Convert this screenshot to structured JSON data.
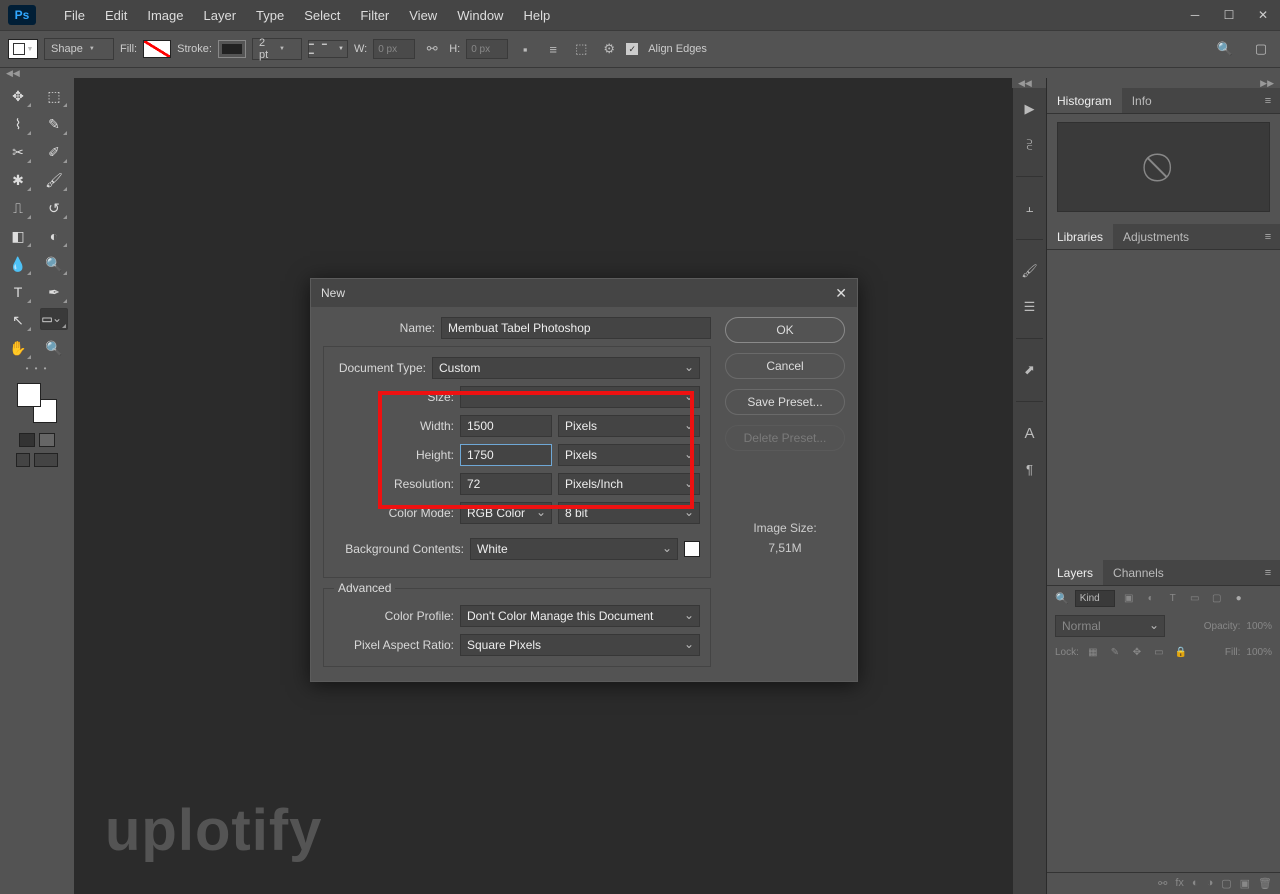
{
  "app": {
    "logo": "Ps"
  },
  "menu": [
    "File",
    "Edit",
    "Image",
    "Layer",
    "Type",
    "Select",
    "Filter",
    "View",
    "Window",
    "Help"
  ],
  "options": {
    "shape": "Shape",
    "fill_label": "Fill:",
    "stroke_label": "Stroke:",
    "stroke_w": "2 pt",
    "w_label": "W:",
    "w_val": "0 px",
    "h_label": "H:",
    "h_val": "0 px",
    "align_edges": "Align Edges"
  },
  "panels": {
    "histogram": "Histogram",
    "info": "Info",
    "libraries": "Libraries",
    "adjustments": "Adjustments",
    "layers": "Layers",
    "channels": "Channels",
    "kind": "Kind",
    "normal": "Normal",
    "opacity_label": "Opacity:",
    "opacity_val": "100%",
    "lock_label": "Lock:",
    "fill_label": "Fill:",
    "fill_val": "100%"
  },
  "dialog": {
    "title": "New",
    "name_label": "Name:",
    "name": "Membuat Tabel Photoshop",
    "doctype_label": "Document Type:",
    "doctype": "Custom",
    "size_label": "Size:",
    "size": "",
    "width_label": "Width:",
    "width": "1500",
    "width_unit": "Pixels",
    "height_label": "Height:",
    "height": "1750",
    "height_unit": "Pixels",
    "res_label": "Resolution:",
    "res": "72",
    "res_unit": "Pixels/Inch",
    "color_label": "Color Mode:",
    "color_mode": "RGB Color",
    "color_bits": "8 bit",
    "bg_label": "Background Contents:",
    "bg": "White",
    "advanced": "Advanced",
    "profile_label": "Color Profile:",
    "profile": "Don't Color Manage this Document",
    "par_label": "Pixel Aspect Ratio:",
    "par": "Square Pixels",
    "ok": "OK",
    "cancel": "Cancel",
    "save_preset": "Save Preset...",
    "delete_preset": "Delete Preset...",
    "image_size_label": "Image Size:",
    "image_size": "7,51M"
  },
  "watermark": "uplotify"
}
